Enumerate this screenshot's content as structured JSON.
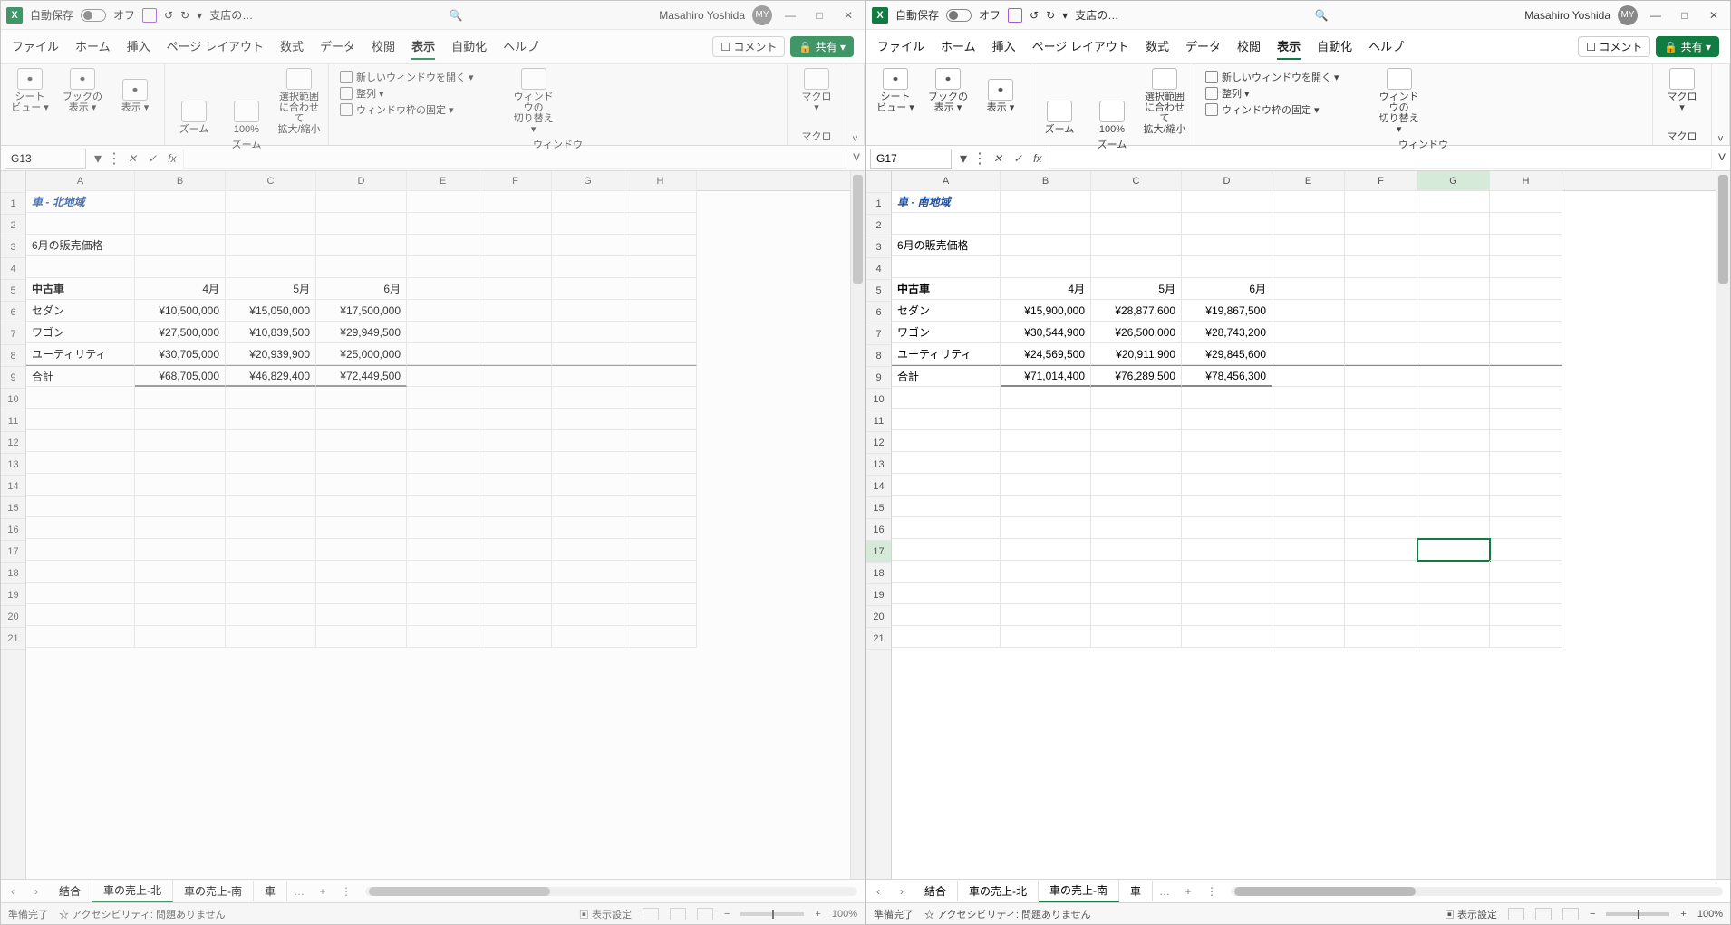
{
  "windows": [
    {
      "active": false,
      "autosave_label": "自動保存",
      "autosave_state": "オフ",
      "doc_short": "支店の…",
      "user": "Masahiro Yoshida",
      "avatar": "MY",
      "ribbon_tabs": [
        "ファイル",
        "ホーム",
        "挿入",
        "ページ レイアウト",
        "数式",
        "データ",
        "校閲",
        "表示",
        "自動化",
        "ヘルプ"
      ],
      "ribbon_active": "表示",
      "comment_btn": "コメント",
      "share_btn": "共有",
      "groups": {
        "view": [
          "シート ビュー",
          "ブックの 表示",
          "表示"
        ],
        "zoom": [
          "ズーム",
          "100%",
          "選択範囲に合わせて 拡大/縮小"
        ],
        "zoom_label": "ズーム",
        "window_items": [
          "新しいウィンドウを開く",
          "整列",
          "ウィンドウ枠の固定"
        ],
        "switch": "ウィンドウの 切り替え",
        "window_label": "ウィンドウ",
        "macro": "マクロ",
        "macro_label": "マクロ"
      },
      "namebox": "G13",
      "columns": [
        "A",
        "B",
        "C",
        "D",
        "E",
        "F",
        "G",
        "H"
      ],
      "rows": 21,
      "title": "車 - 北地域",
      "subtitle": "6月の販売価格",
      "header": [
        "中古車",
        "4月",
        "5月",
        "6月"
      ],
      "data": [
        [
          "セダン",
          "¥10,500,000",
          "¥15,050,000",
          "¥17,500,000"
        ],
        [
          "ワゴン",
          "¥27,500,000",
          "¥10,839,500",
          "¥29,949,500"
        ],
        [
          "ユーティリティ",
          "¥30,705,000",
          "¥20,939,900",
          "¥25,000,000"
        ],
        [
          "合計",
          "¥68,705,000",
          "¥46,829,400",
          "¥72,449,500"
        ]
      ],
      "sheets": [
        "結合",
        "車の売上-北",
        "車の売上-南",
        "車"
      ],
      "active_sheet": 1,
      "sel_row": -1,
      "sel_col": -1,
      "status_ready": "準備完了",
      "status_acc": "アクセシビリティ: 問題ありません",
      "status_disp": "表示設定",
      "zoom": "100%"
    },
    {
      "active": true,
      "autosave_label": "自動保存",
      "autosave_state": "オフ",
      "doc_short": "支店の…",
      "user": "Masahiro Yoshida",
      "avatar": "MY",
      "ribbon_tabs": [
        "ファイル",
        "ホーム",
        "挿入",
        "ページ レイアウト",
        "数式",
        "データ",
        "校閲",
        "表示",
        "自動化",
        "ヘルプ"
      ],
      "ribbon_active": "表示",
      "comment_btn": "コメント",
      "share_btn": "共有",
      "groups": {
        "view": [
          "シート ビュー",
          "ブックの 表示",
          "表示"
        ],
        "zoom": [
          "ズーム",
          "100%",
          "選択範囲に合わせて 拡大/縮小"
        ],
        "zoom_label": "ズーム",
        "window_items": [
          "新しいウィンドウを開く",
          "整列",
          "ウィンドウ枠の固定"
        ],
        "switch": "ウィンドウの 切り替え",
        "window_label": "ウィンドウ",
        "macro": "マクロ",
        "macro_label": "マクロ"
      },
      "namebox": "G17",
      "columns": [
        "A",
        "B",
        "C",
        "D",
        "E",
        "F",
        "G",
        "H"
      ],
      "rows": 21,
      "title": "車 - 南地域",
      "subtitle": "6月の販売価格",
      "header": [
        "中古車",
        "4月",
        "5月",
        "6月"
      ],
      "data": [
        [
          "セダン",
          "¥15,900,000",
          "¥28,877,600",
          "¥19,867,500"
        ],
        [
          "ワゴン",
          "¥30,544,900",
          "¥26,500,000",
          "¥28,743,200"
        ],
        [
          "ユーティリティ",
          "¥24,569,500",
          "¥20,911,900",
          "¥29,845,600"
        ],
        [
          "合計",
          "¥71,014,400",
          "¥76,289,500",
          "¥78,456,300"
        ]
      ],
      "sheets": [
        "結合",
        "車の売上-北",
        "車の売上-南",
        "車"
      ],
      "active_sheet": 2,
      "sel_row": 17,
      "sel_col": 6,
      "status_ready": "準備完了",
      "status_acc": "アクセシビリティ: 問題ありません",
      "status_disp": "表示設定",
      "zoom": "100%"
    }
  ]
}
